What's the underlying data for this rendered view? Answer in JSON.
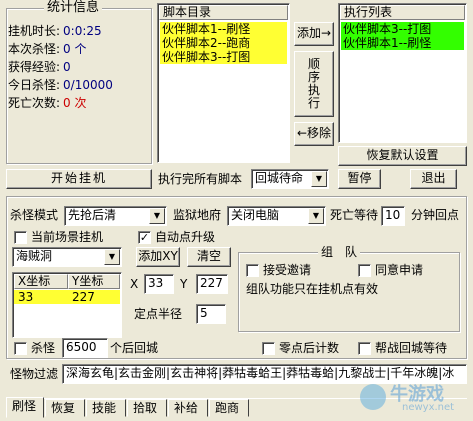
{
  "stats": {
    "title": "统计信息",
    "rows": [
      {
        "label": "挂机时长:",
        "value": "0:0:25",
        "color": "#000080"
      },
      {
        "label": "本次杀怪:",
        "value": "0 个",
        "color": "#000080"
      },
      {
        "label": "获得经验:",
        "value": "0",
        "color": "#000080"
      },
      {
        "label": "今日杀怪:",
        "value": "0/10000",
        "color": "#000080"
      },
      {
        "label": "死亡次数:",
        "value": "0 次",
        "color": "#cc0000"
      }
    ]
  },
  "script_dir": {
    "title": "脚本目录",
    "items": [
      "伙伴脚本1--刷怪",
      "伙伴脚本2--跑商",
      "伙伴脚本3--打图"
    ]
  },
  "exec_list": {
    "title": "执行列表",
    "items": [
      "伙伴脚本3--打图",
      "伙伴脚本1--刷怪"
    ]
  },
  "buttons": {
    "add": "添加→",
    "order": [
      "顺",
      "序",
      "执",
      "行"
    ],
    "remove": "←移除",
    "restore": "恢复默认设置",
    "start": "开始挂机",
    "pause": "暂停",
    "exit": "退出",
    "add_xy": "添加XY",
    "clear": "清空"
  },
  "after_all": {
    "label": "执行完所有脚本",
    "value": "回城待命"
  },
  "options": {
    "kill_mode_label": "杀怪模式",
    "kill_mode_value": "先抢后清",
    "jail_label": "监狱地府",
    "jail_value": "关闭电脑",
    "death_wait_label": "死亡等待",
    "death_wait_value": "10",
    "death_wait_unit": "分钟回点",
    "current_scene": "当前场景挂机",
    "auto_upgrade": "自动点升级",
    "map_value": "海贼洞",
    "coord_headers": [
      "X坐标",
      "Y坐标"
    ],
    "coords": [
      {
        "x": "33",
        "y": "227"
      }
    ],
    "x_label": "X",
    "x_value": "33",
    "y_label": "Y",
    "y_value": "227",
    "radius_label": "定点半径",
    "radius_value": "5"
  },
  "team": {
    "title": "组　队",
    "accept_invite": "接受邀请",
    "agree_apply": "同意申请",
    "note": "组队功能只在挂机点有效"
  },
  "bottom": {
    "kill_label": "杀怪",
    "kill_value": "6500",
    "kill_suffix": "个后回城",
    "zero_label": "零点后计数",
    "help_label": "帮战回城等待",
    "filter_label": "怪物过滤",
    "filter_value": "深海玄龟|玄击金刚|玄击神将|莽牯毒蛤王|莽牯毒蛤|九黎战士|千年冰魄|冰"
  },
  "tabs": [
    "刷怪",
    "恢复",
    "技能",
    "拾取",
    "补给",
    "跑商"
  ],
  "watermark": {
    "big": "牛游戏",
    "small": "newyx.net"
  },
  "colors": {
    "highlight_yellow": "#ffff33",
    "highlight_green": "#33ff00"
  }
}
